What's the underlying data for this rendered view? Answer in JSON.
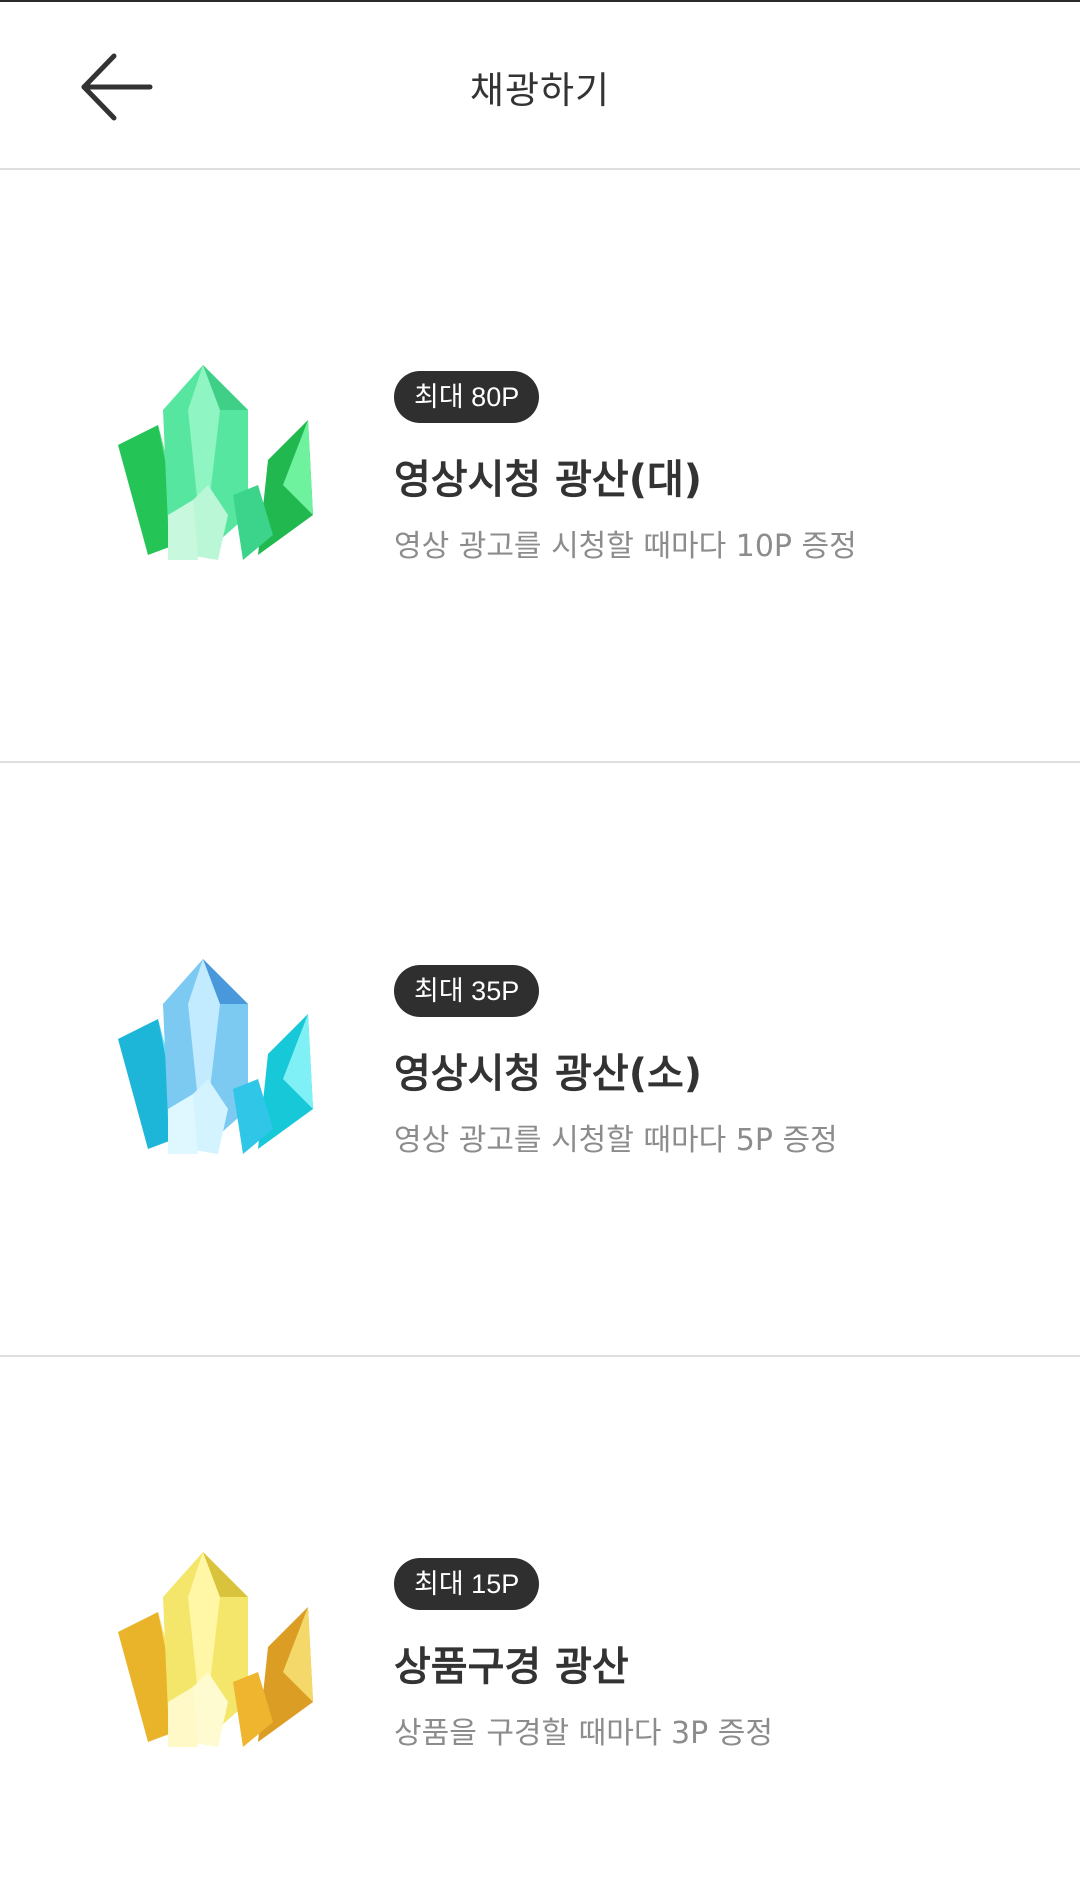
{
  "header": {
    "title": "채광하기",
    "back_icon": "arrow-left-icon"
  },
  "mines": [
    {
      "badge": "최대 80P",
      "title": "영상시청 광산(대)",
      "desc": "영상 광고를 시청할 때마다 10P 증정",
      "icon": "green-crystal-icon",
      "colors": [
        "#2fd36a",
        "#7ff0b0",
        "#1bb34f"
      ]
    },
    {
      "badge": "최대 35P",
      "title": "영상시청 광산(소)",
      "desc": "영상 광고를 시청할 때마다 5P 증정",
      "icon": "blue-crystal-icon",
      "colors": [
        "#2ec8e6",
        "#9fe6ff",
        "#4a9ee0"
      ]
    },
    {
      "badge": "최대 15P",
      "title": "상품구경 광산",
      "desc": "상품을 구경할 때마다 3P 증정",
      "icon": "yellow-crystal-icon",
      "colors": [
        "#f0c534",
        "#fff58a",
        "#e3a22a"
      ]
    }
  ]
}
